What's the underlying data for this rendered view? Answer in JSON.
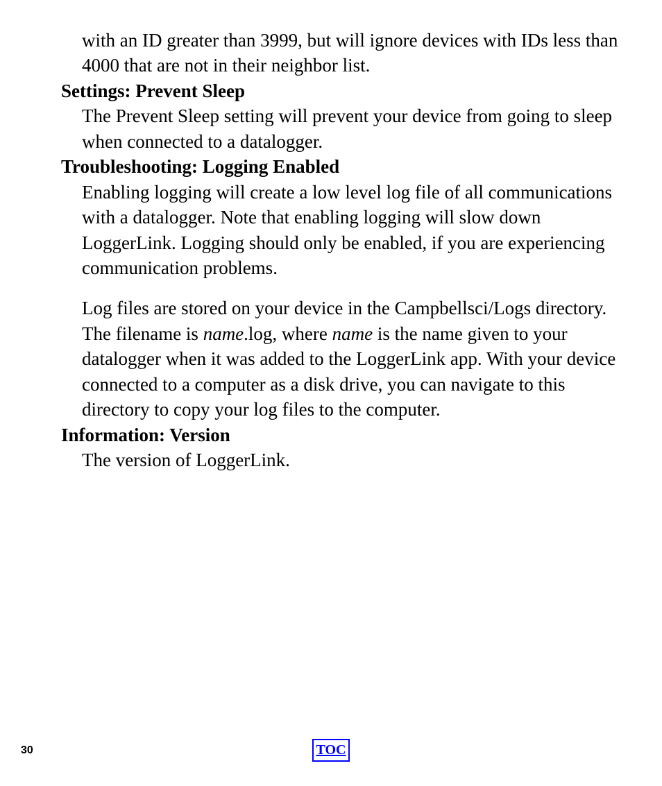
{
  "content": {
    "partial_text": "with an ID greater than 3999, but will ignore devices with IDs less than 4000 that are not in their neighbor list.",
    "heading1": "Settings: Prevent Sleep",
    "text1": "The Prevent Sleep setting will prevent your device from going to sleep when connected to a datalogger.",
    "heading2": "Troubleshooting: Logging Enabled",
    "text2": "Enabling logging will create a low level log file of all communications with a datalogger.  Note that enabling logging will slow down LoggerLink.  Logging should only be enabled, if you are experiencing communication problems.",
    "text3a": "Log files are stored on your device in the Campbellsci/Logs directory.  The filename is ",
    "text3b": "name",
    "text3c": ".log, where ",
    "text3d": "name",
    "text3e": " is the name given to your datalogger when it was added to the LoggerLink app.  With your device connected to a computer as a disk drive, you can navigate to this directory to copy your log files to the computer.",
    "heading3": "Information: Version",
    "text4": "The version of LoggerLink."
  },
  "footer": {
    "page_number": "30",
    "toc_label": "TOC"
  }
}
